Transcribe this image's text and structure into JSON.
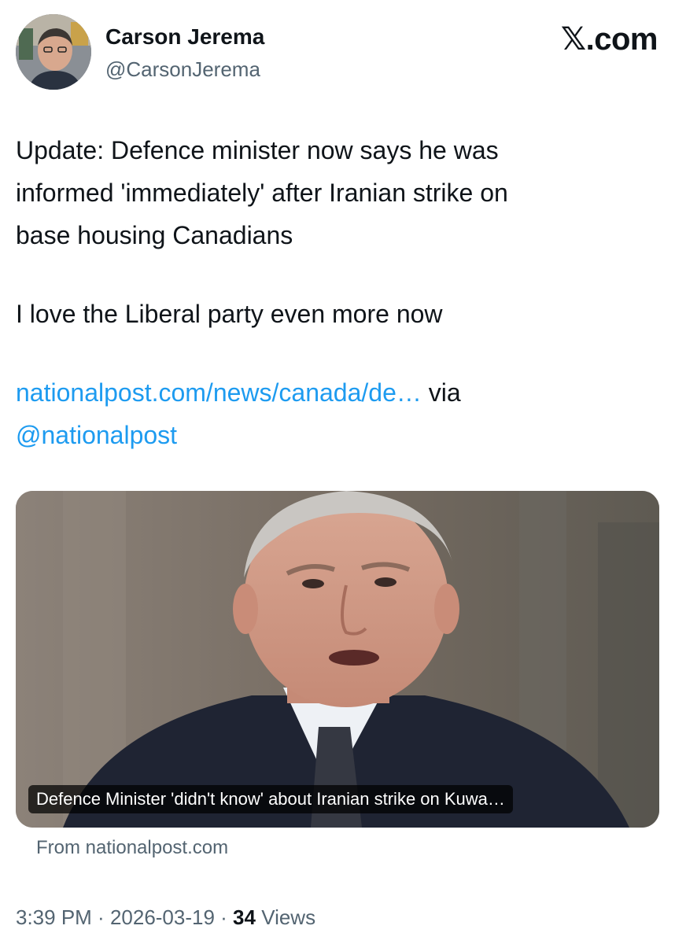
{
  "author": {
    "name": "Carson Jerema",
    "handle": "@CarsonJerema",
    "avatar_icon": "profile-photo"
  },
  "brand": {
    "logo": "𝕏",
    "label": ".com"
  },
  "tweet": {
    "line1": "Update: Defence minister now says he was",
    "line2": "informed 'immediately' after Iranian strike on",
    "line3": "base housing Canadians",
    "line4": "I love the Liberal party even more now",
    "link_url": "nationalpost.com/news/canada/de…",
    "via": " via",
    "mention": "@nationalpost"
  },
  "card": {
    "caption": "Defence Minister 'didn't know' about Iranian strike on Kuwa…",
    "source": "From nationalpost.com"
  },
  "meta": {
    "time": "3:39 PM",
    "separator": " · ",
    "date": "2026-03-19",
    "views_count": "34",
    "views_label": " Views"
  },
  "colors": {
    "link": "#1d9bf0",
    "secondary_text": "#536471",
    "primary_text": "#0f1419"
  }
}
